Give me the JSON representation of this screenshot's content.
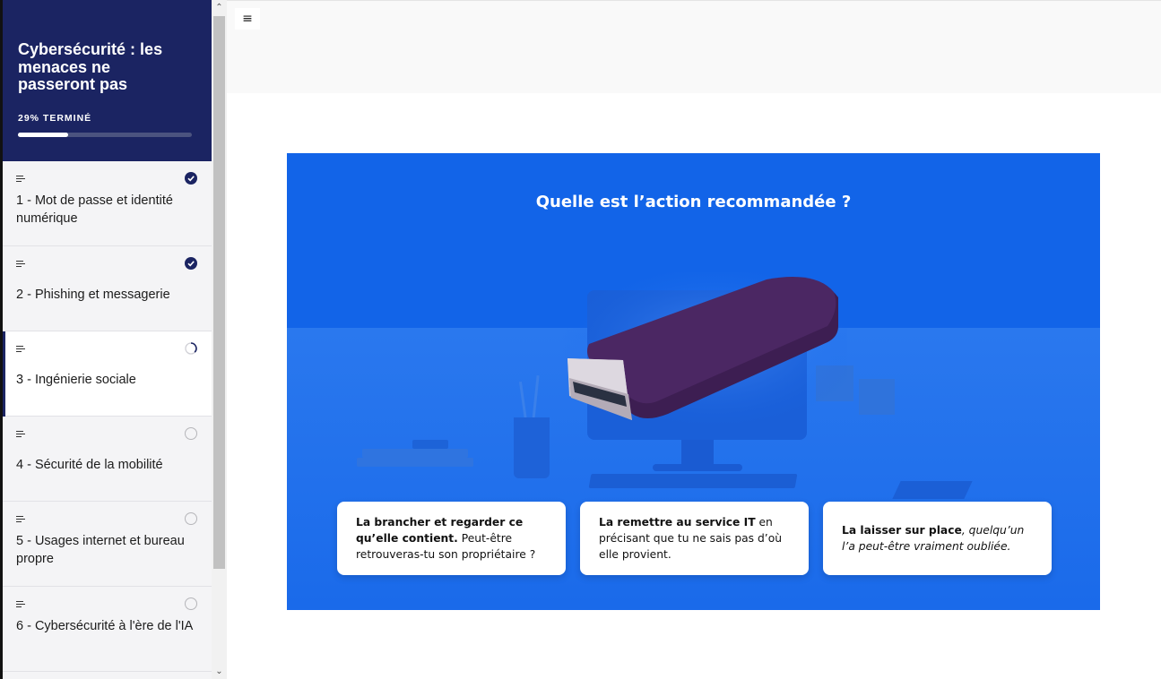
{
  "course": {
    "title": "Cybersécurité : les menaces ne passeront pas",
    "progress_label": "29% TERMINÉ",
    "progress_fraction": 0.29
  },
  "lessons": [
    {
      "label": "1 - Mot de passe et identité numérique",
      "status": "completed",
      "icon": "text-lines-icon"
    },
    {
      "label": "2 - Phishing et messagerie",
      "status": "completed",
      "icon": "text-lines-icon"
    },
    {
      "label": "3 - Ingénierie sociale",
      "status": "in-progress",
      "icon": "text-lines-icon"
    },
    {
      "label": "4 - Sécurité de la mobilité",
      "status": "not-started",
      "icon": "text-lines-icon"
    },
    {
      "label": "5 - Usages internet et bureau propre",
      "status": "not-started",
      "icon": "text-lines-icon"
    },
    {
      "label": "6 - Cybersécurité à l'ère de l'IA",
      "status": "not-started",
      "icon": "text-lines-icon"
    }
  ],
  "topbar": {
    "menu_icon": "hamburger-menu-icon",
    "menu_glyph": "≡"
  },
  "question": {
    "title": "Quelle est l’action recommandée ?"
  },
  "answers": [
    {
      "bold": "La brancher et regarder ce qu’elle contient.",
      "rest": " Peut-être retrouveras-tu son propriétaire ?"
    },
    {
      "bold": "La remettre au service IT",
      "rest": " en précisant que tu ne sais pas d’où elle provient."
    },
    {
      "bold": "La laisser sur place",
      "rest": ", quelqu’un l’a peut-être vraiment oubliée."
    }
  ],
  "colors": {
    "sidebar_header": "#1b2462",
    "stage_blue": "#1264e8",
    "usb_body": "#4a2560"
  },
  "scroll": {
    "up_glyph": "⌃",
    "down_glyph": "⌄"
  }
}
